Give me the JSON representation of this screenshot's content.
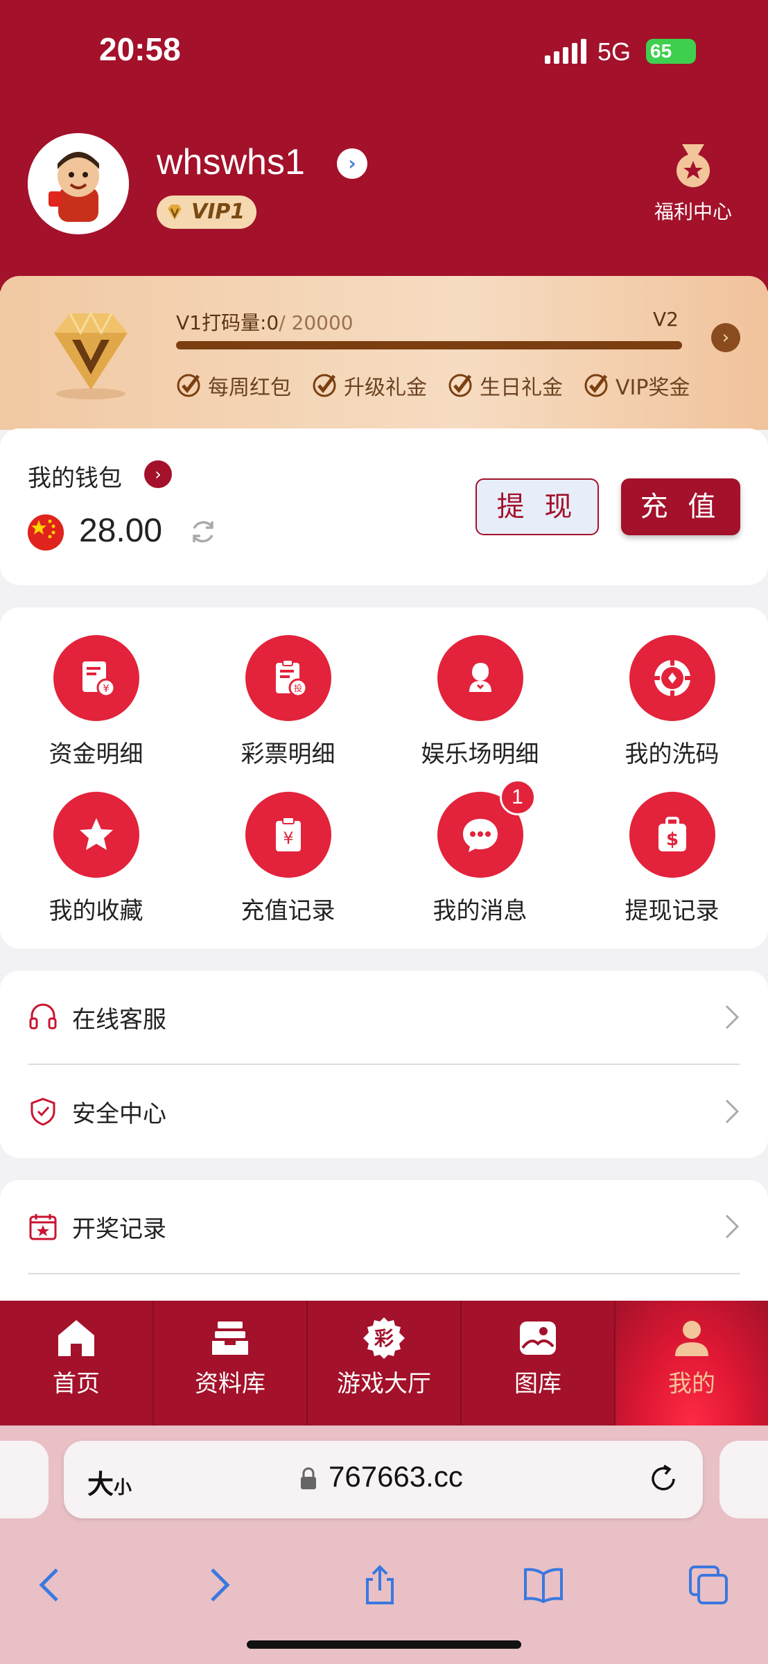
{
  "status_bar": {
    "time": "20:58",
    "network": "5G",
    "battery": "65"
  },
  "profile": {
    "username": "whswhs1",
    "vip_badge": "VIP1",
    "welfare_label": "福利中心"
  },
  "vip_card": {
    "current_level_text": "V1打码量:0",
    "target_text": "/ 20000",
    "next_level": "V2",
    "progress": 0,
    "perks": [
      "每周红包",
      "升级礼金",
      "生日礼金",
      "VIP奖金"
    ]
  },
  "wallet": {
    "title": "我的钱包",
    "balance": "28.00",
    "withdraw_label": "提 现",
    "deposit_label": "充 值"
  },
  "shortcuts": [
    {
      "label": "资金明细",
      "icon": "fund-detail-icon"
    },
    {
      "label": "彩票明细",
      "icon": "lottery-detail-icon"
    },
    {
      "label": "娱乐场明细",
      "icon": "casino-detail-icon"
    },
    {
      "label": "我的洗码",
      "icon": "chip-icon"
    },
    {
      "label": "我的收藏",
      "icon": "star-icon"
    },
    {
      "label": "充值记录",
      "icon": "deposit-record-icon"
    },
    {
      "label": "我的消息",
      "icon": "message-icon",
      "badge": "1"
    },
    {
      "label": "提现记录",
      "icon": "withdraw-record-icon"
    }
  ],
  "menu": [
    {
      "label": "在线客服",
      "icon": "headset-icon"
    },
    {
      "label": "安全中心",
      "icon": "shield-icon"
    },
    {
      "label": "开奖记录",
      "icon": "calendar-star-icon"
    }
  ],
  "tabbar": [
    {
      "label": "首页",
      "icon": "home-icon"
    },
    {
      "label": "资料库",
      "icon": "archive-icon"
    },
    {
      "label": "游戏大厅",
      "icon": "game-hall-icon",
      "icon_text": "彩"
    },
    {
      "label": "图库",
      "icon": "gallery-icon"
    },
    {
      "label": "我的",
      "icon": "user-icon",
      "active": true
    }
  ],
  "browser": {
    "text_size_big": "大",
    "text_size_small": "小",
    "url": "767663.cc"
  },
  "colors": {
    "brand_red": "#a3112a",
    "icon_red": "#e2233b",
    "gold": "#f3c59a"
  }
}
